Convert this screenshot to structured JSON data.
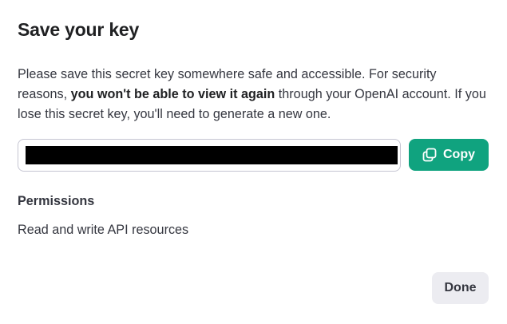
{
  "dialog": {
    "title": "Save your key",
    "description": {
      "part1": "Please save this secret key somewhere safe and accessible. For security reasons, ",
      "bold": "you won't be able to view it again",
      "part2": " through your OpenAI account. If you lose this secret key, you'll need to generate a new one."
    },
    "key_field": {
      "value": "",
      "redacted": true
    },
    "copy_button": {
      "label": "Copy",
      "icon": "copy-icon",
      "color": "#10a37f"
    },
    "permissions": {
      "heading": "Permissions",
      "value": "Read and write API resources"
    },
    "done_button": {
      "label": "Done",
      "color": "#ececf1"
    }
  }
}
